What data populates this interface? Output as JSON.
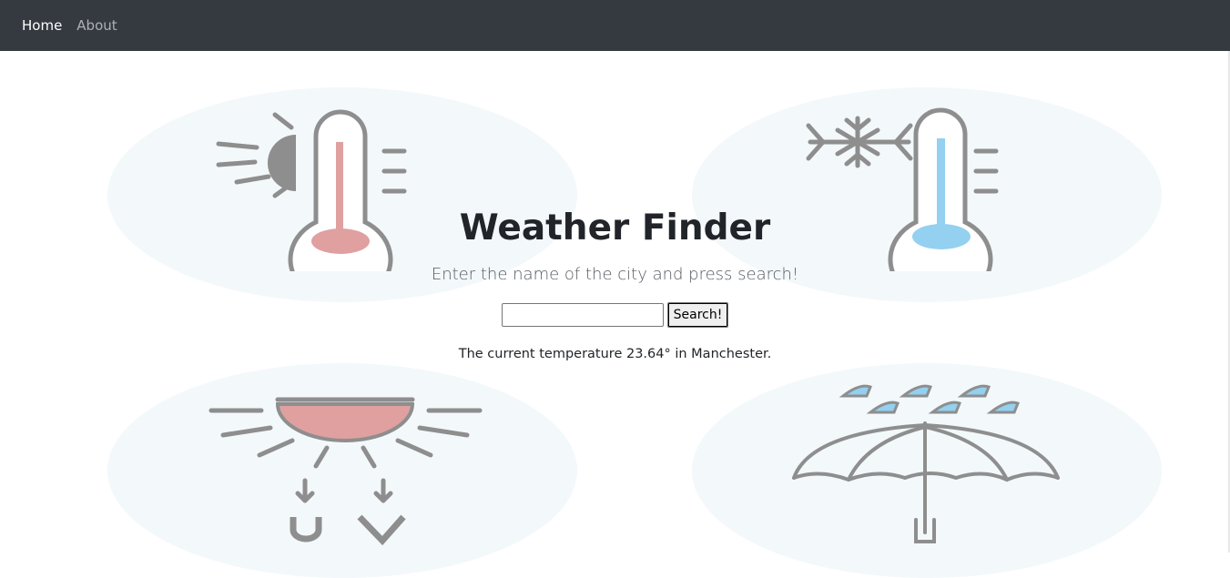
{
  "navbar": {
    "links": [
      {
        "label": "Home",
        "active": true
      },
      {
        "label": "About",
        "active": false
      }
    ],
    "background": "#343a40"
  },
  "main": {
    "title": "Weather Finder",
    "subtitle": "Enter the name of the city and press search!",
    "search": {
      "value": "",
      "placeholder": "",
      "button_label": "Search!"
    },
    "result_text": "The current temperature 23.64° in Manchester."
  },
  "illustrations": [
    {
      "icon": "hot-thermometer-icon"
    },
    {
      "icon": "cold-thermometer-icon"
    },
    {
      "icon": "uv-sun-icon"
    },
    {
      "icon": "umbrella-rain-icon"
    }
  ],
  "colors": {
    "blob": "#f3f8fb",
    "icon_gray": "#8e8e8e",
    "warm": "#e0a0a0",
    "cold": "#94d0ef"
  }
}
